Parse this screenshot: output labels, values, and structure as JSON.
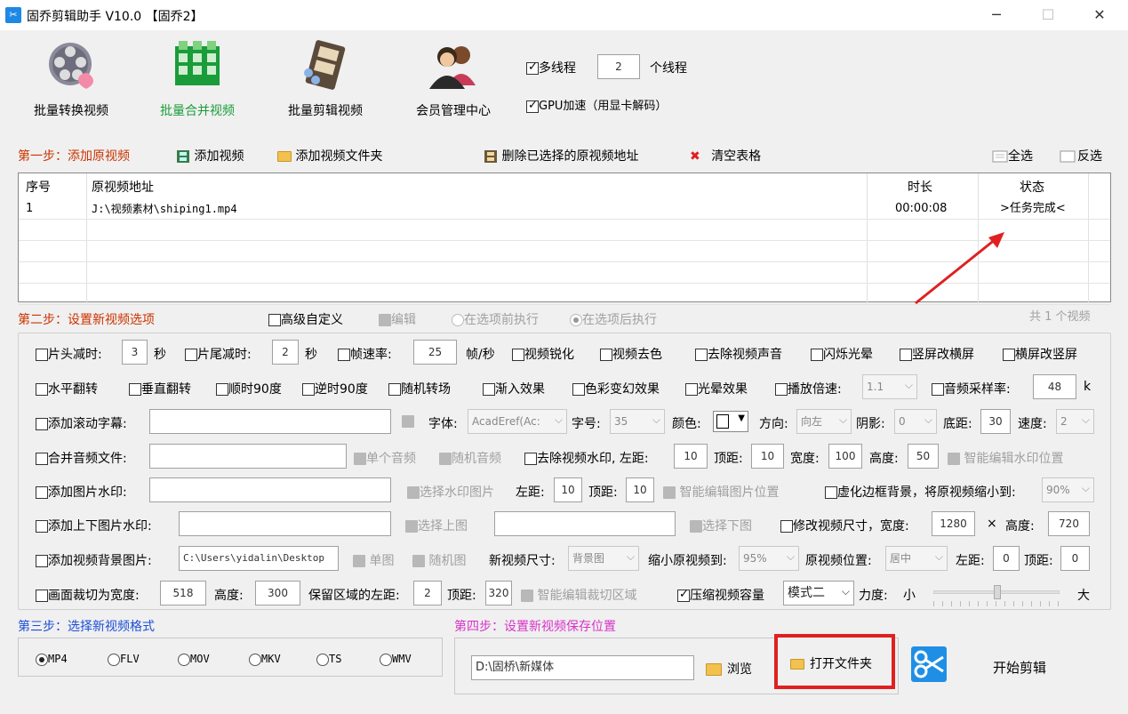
{
  "window": {
    "title": "固乔剪辑助手 V10.0 【固乔2】",
    "app_icon": "scissors-icon",
    "min": "─",
    "max": "☐",
    "close": "✕"
  },
  "toolbar": {
    "batch_convert": "批量转换视频",
    "batch_merge": "批量合并视频",
    "batch_edit": "批量剪辑视频",
    "member_center": "会员管理中心",
    "multithread_label": "多线程",
    "thread_count": "2",
    "thread_unit": "个线程",
    "gpu_label": "GPU加速（用显卡解码）",
    "accent_color": "#1a9c3a"
  },
  "step1": {
    "title": "第一步：添加原视频",
    "add_video": "添加视频",
    "add_folder": "添加视频文件夹",
    "delete_selected": "删除已选择的原视频地址",
    "clear_table": "清空表格",
    "select_all": "全选",
    "invert": "反选"
  },
  "table": {
    "headers": [
      "序号",
      "原视频地址",
      "时长",
      "状态"
    ],
    "rows": [
      {
        "no": "1",
        "path": "J:\\视频素材\\shiping1.mp4",
        "duration": "00:00:08",
        "status": ">任务完成<"
      }
    ]
  },
  "step2": {
    "title": "第二步：设置新视频选项",
    "advanced": "高级自定义",
    "edit": "编辑",
    "before": "在选项前执行",
    "after": "在选项后执行",
    "count": "共 1 个视频"
  },
  "opts": {
    "r1": {
      "head_cut": "片头减时:",
      "head_val": "3",
      "sec": "秒",
      "tail_cut": "片尾减时:",
      "tail_val": "2",
      "sec2": "秒",
      "fps": "帧速率:",
      "fps_val": "25",
      "fps_unit": "帧/秒",
      "sharpen": "视频锐化",
      "decolor": "视频去色",
      "mute": "去除视频声音",
      "flash": "闪烁光晕",
      "v2h": "竖屏改横屏",
      "h2v": "横屏改竖屏"
    },
    "r2": {
      "hflip": "水平翻转",
      "vflip": "垂直翻转",
      "cw90": "顺时90度",
      "ccw90": "逆时90度",
      "trans": "随机转场",
      "fade": "渐入效果",
      "color": "色彩变幻效果",
      "halo": "光晕效果",
      "speed": "播放倍速:",
      "speed_val": "1.1",
      "samplerate": "音频采样率:",
      "samplerate_val": "48",
      "k": "k"
    },
    "r3": {
      "subtitle": "添加滚动字幕:",
      "font": "字体:",
      "font_val": "AcadEref(Ac:",
      "size": "字号:",
      "size_val": "35",
      "color": "颜色:",
      "dir": "方向:",
      "dir_val": "向左",
      "shadow": "阴影:",
      "shadow_val": "0",
      "bottom": "底距:",
      "bottom_val": "30",
      "speed": "速度:",
      "speed_val": "2"
    },
    "r4": {
      "merge_audio": "合并音频文件:",
      "single": "单个音频",
      "random": "随机音频",
      "rm_wm": "去除视频水印, 左距:",
      "left": "10",
      "top_l": "顶距:",
      "top": "10",
      "w_l": "宽度:",
      "w": "100",
      "h_l": "高度:",
      "h": "50",
      "smart": "智能编辑水印位置"
    },
    "r5": {
      "img_wm": "添加图片水印:",
      "choose": "选择水印图片",
      "left_l": "左距:",
      "left": "10",
      "top_l": "顶距:",
      "top": "10",
      "smart": "智能编辑图片位置",
      "blur": "虚化边框背景，将原视频缩小到:",
      "blur_val": "90%"
    },
    "r6": {
      "tb_wm": "添加上下图片水印:",
      "choose_top": "选择上图",
      "choose_bottom": "选择下图",
      "resize": "修改视频尺寸，宽度:",
      "w": "1280",
      "x": "×",
      "h_l": "高度:",
      "h": "720"
    },
    "r7": {
      "bg": "添加视频背景图片:",
      "bg_val": "C:\\Users\\yidalin\\Desktop",
      "single": "单图",
      "random": "随机图",
      "newsize": "新视频尺寸:",
      "newsize_val": "背景图",
      "shrink": "缩小原视频到:",
      "shrink_val": "95%",
      "pos": "原视频位置:",
      "pos_val": "居中",
      "left_l": "左距:",
      "left": "0",
      "top_l": "顶距:",
      "top": "0"
    },
    "r8": {
      "crop": "画面裁切为宽度:",
      "crop_w": "518",
      "h_l": "高度:",
      "h": "300",
      "keep": "保留区域的左距:",
      "keep_val": "2",
      "top_l": "顶距:",
      "top": "320",
      "smart": "智能编辑裁切区域",
      "compress": "压缩视频容量",
      "mode": "模式二",
      "force": "力度:",
      "small": "小",
      "big": "大",
      "force_level": 0.5
    }
  },
  "step3": {
    "title": "第三步：选择新视频格式",
    "formats": [
      "MP4",
      "FLV",
      "MOV",
      "MKV",
      "TS",
      "WMV"
    ],
    "selected": "MP4"
  },
  "step4": {
    "title": "第四步：设置新视频保存位置",
    "path": "D:\\固桥\\新媒体",
    "browse": "浏览",
    "open_folder": "打开文件夹"
  },
  "start": {
    "label": "开始剪辑"
  }
}
